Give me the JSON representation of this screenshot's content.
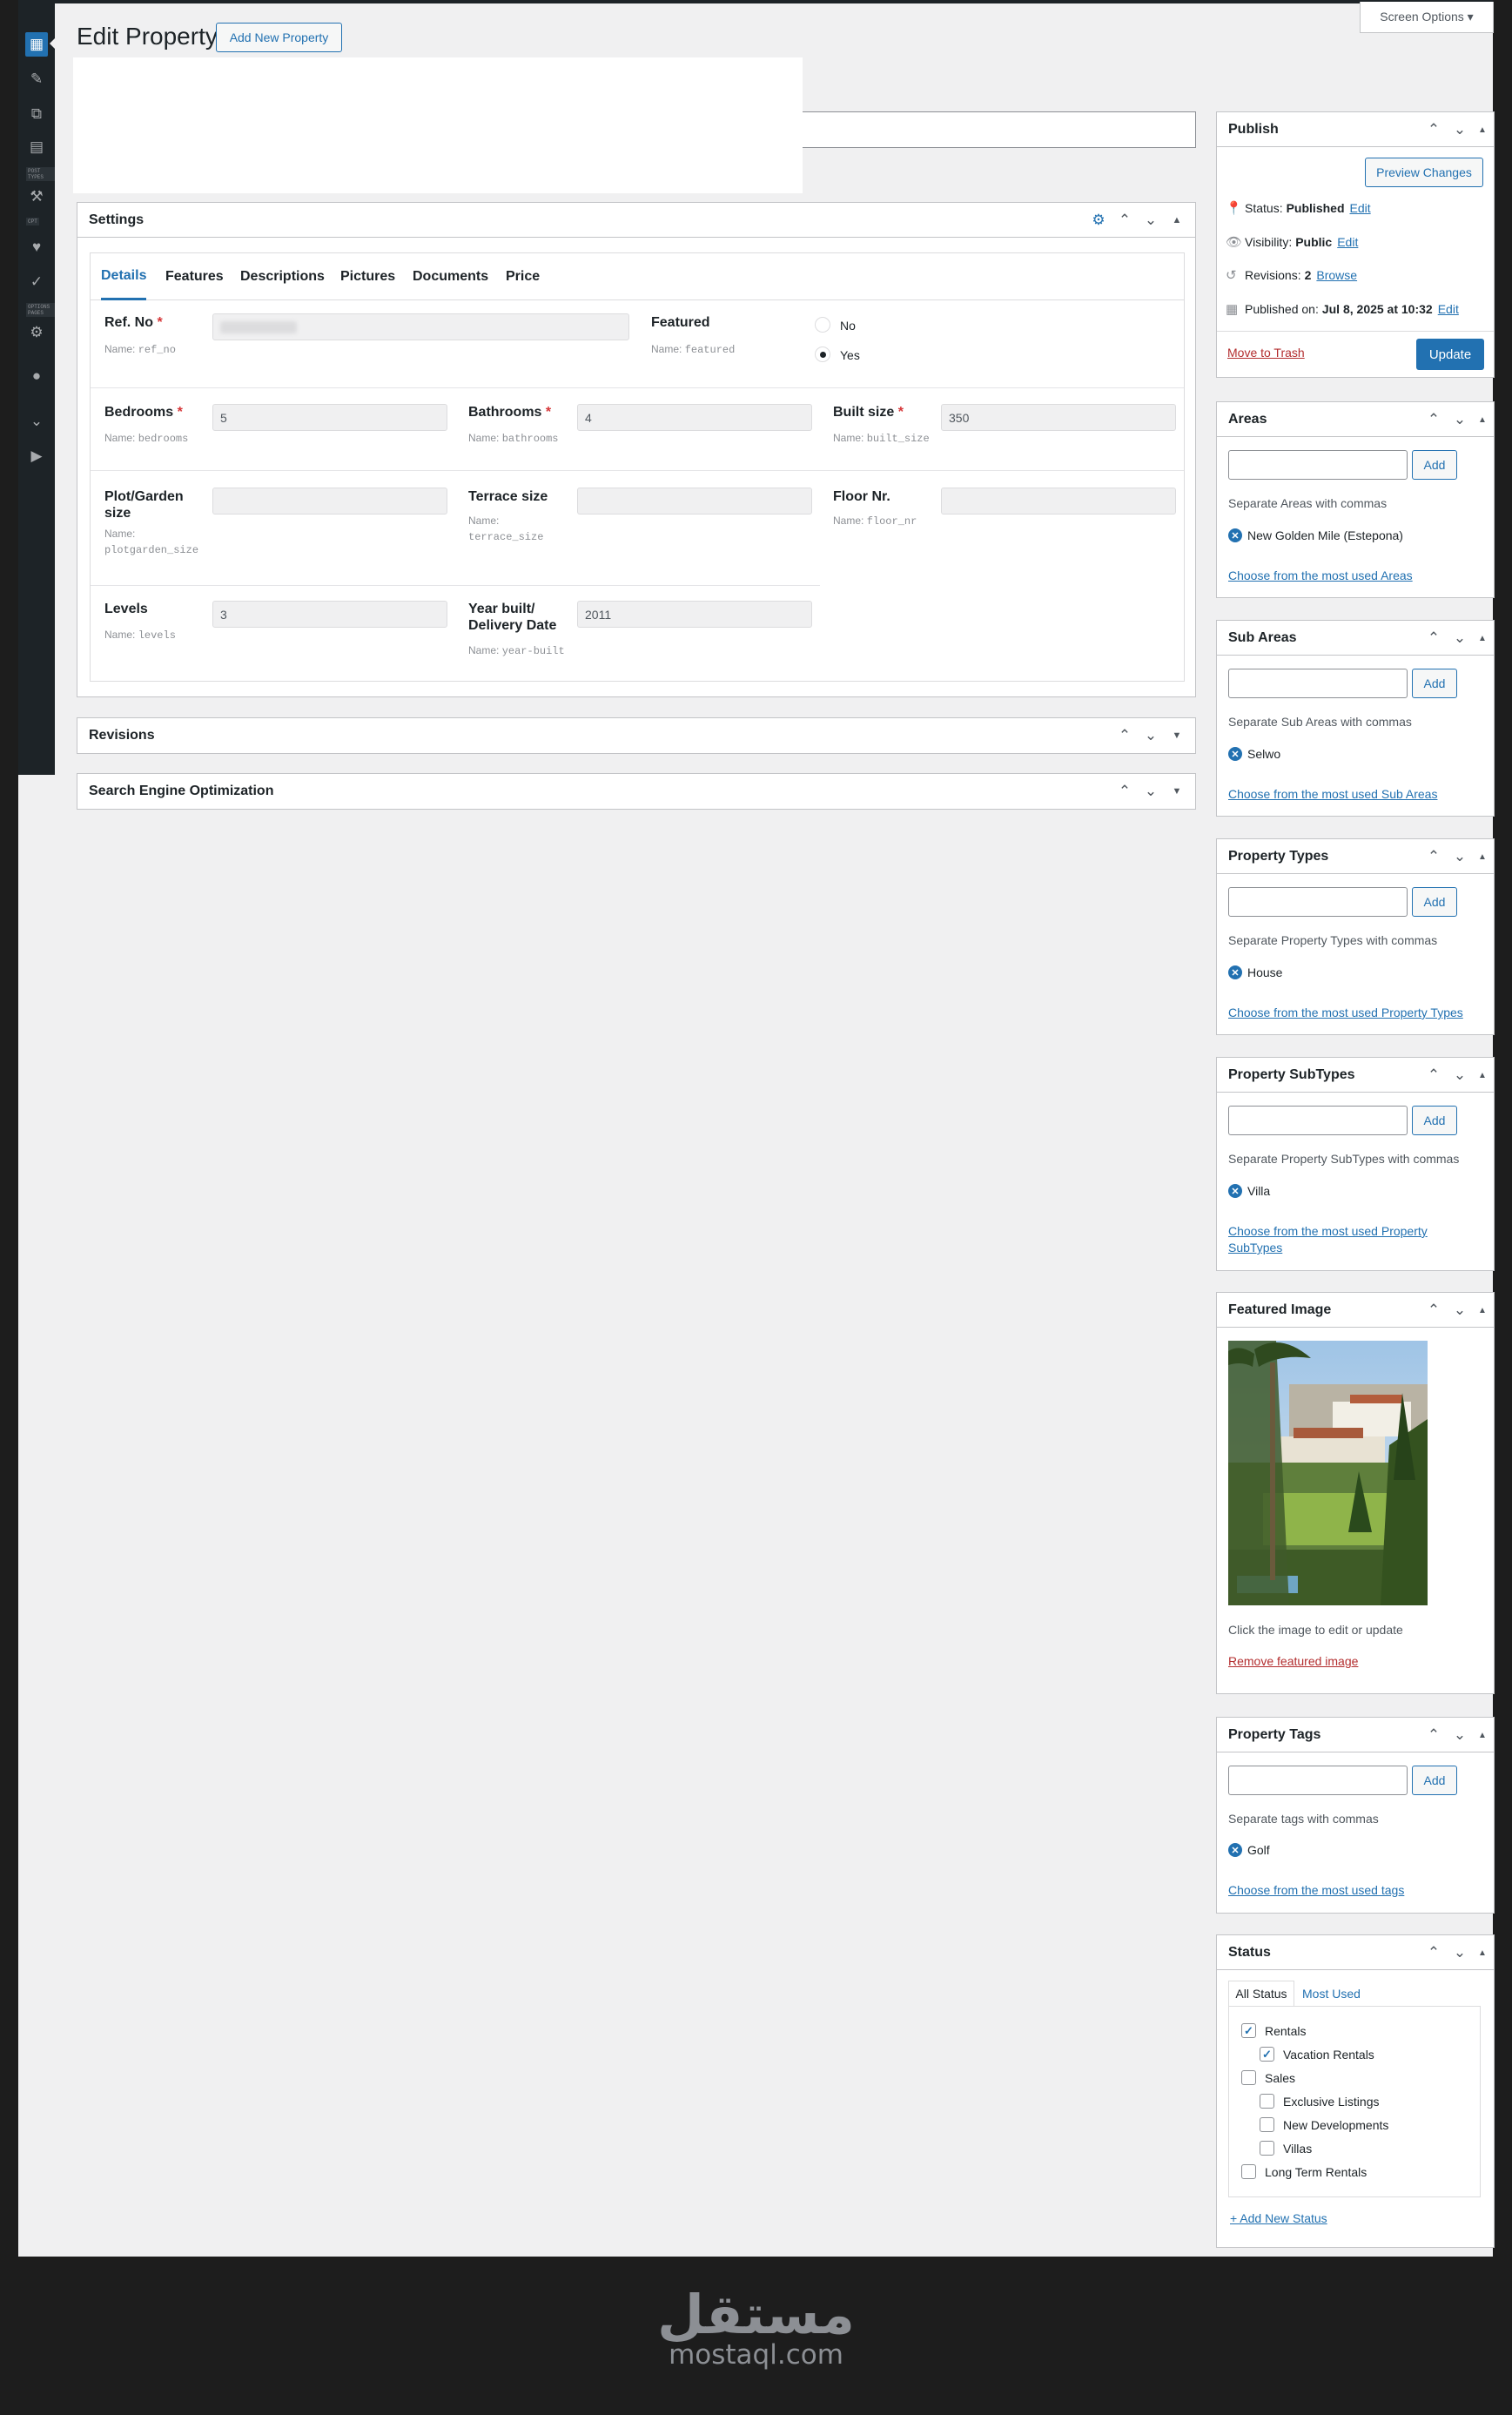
{
  "header": {
    "title": "Edit Property",
    "add_new_label": "Add New Property",
    "screen_options_label": "Screen Options ▾"
  },
  "sidebar": {
    "sections": [
      "POST TYPES",
      "CPT",
      "OPTIONS PAGES"
    ],
    "icons": [
      "building-icon",
      "pin-icon",
      "media-icon",
      "pages-icon",
      "wrench-icon",
      "heart-icon",
      "check-icon",
      "tools-icon",
      "user-icon",
      "collapse-icon",
      "play-icon"
    ]
  },
  "settings": {
    "title": "Settings",
    "tabs": [
      "Details",
      "Features",
      "Descriptions",
      "Pictures",
      "Documents",
      "Price"
    ],
    "active_tab": "Details",
    "fields": {
      "ref_no": {
        "label": "Ref. No",
        "required": "*",
        "name_prefix": "Name:",
        "name": "ref_no",
        "value": ""
      },
      "featured": {
        "label": "Featured",
        "name_prefix": "Name:",
        "name": "featured",
        "options": [
          "No",
          "Yes"
        ],
        "selected": "Yes"
      },
      "bedrooms": {
        "label": "Bedrooms",
        "required": "*",
        "name_prefix": "Name:",
        "name": "bedrooms",
        "value": "5"
      },
      "bathrooms": {
        "label": "Bathrooms",
        "required": "*",
        "name_prefix": "Name:",
        "name": "bathrooms",
        "value": "4"
      },
      "built_size": {
        "label": "Built size",
        "required": "*",
        "name_prefix": "Name:",
        "name": "built_size",
        "value": "350"
      },
      "plot_size": {
        "label_line1": "Plot/Garden",
        "label_line2": "size",
        "name_prefix": "Name:",
        "name": "plotgarden_size",
        "value": ""
      },
      "terrace_size": {
        "label": "Terrace size",
        "name_prefix": "Name:",
        "name": "terrace_size",
        "value": ""
      },
      "floor_nr": {
        "label": "Floor Nr.",
        "name_prefix": "Name:",
        "name": "floor_nr",
        "value": ""
      },
      "levels": {
        "label": "Levels",
        "name_prefix": "Name:",
        "name": "levels",
        "value": "3"
      },
      "year_built": {
        "label_line1": "Year built/",
        "label_line2": "Delivery Date",
        "name_prefix": "Name:",
        "name": "year-built",
        "value": "2011"
      }
    }
  },
  "revisions_box": {
    "title": "Revisions"
  },
  "seo_box": {
    "title": "Search Engine Optimization"
  },
  "publish": {
    "title": "Publish",
    "preview_label": "Preview Changes",
    "status_label": "Status:",
    "status_value": "Published",
    "status_edit": "Edit",
    "visibility_label": "Visibility:",
    "visibility_value": "Public",
    "visibility_edit": "Edit",
    "revisions_label": "Revisions:",
    "revisions_value": "2",
    "revisions_browse": "Browse",
    "published_label": "Published on:",
    "published_value": "Jul 8, 2025 at 10:32",
    "published_edit": "Edit",
    "trash_label": "Move to Trash",
    "update_label": "Update"
  },
  "taxonomies": {
    "areas": {
      "title": "Areas",
      "add": "Add",
      "hint": "Separate Areas with commas",
      "tag": "New Golden Mile (Estepona)",
      "link": "Choose from the most used Areas"
    },
    "sub_areas": {
      "title": "Sub Areas",
      "add": "Add",
      "hint": "Separate Sub Areas with commas",
      "tag": "Selwo",
      "link": "Choose from the most used Sub Areas"
    },
    "types": {
      "title": "Property Types",
      "add": "Add",
      "hint": "Separate Property Types with commas",
      "tag": "House",
      "link": "Choose from the most used Property Types"
    },
    "subtypes": {
      "title": "Property SubTypes",
      "add": "Add",
      "hint": "Separate Property SubTypes with commas",
      "tag": "Villa",
      "link_line1": "Choose from the most used Property",
      "link_line2": "SubTypes"
    },
    "tags": {
      "title": "Property Tags",
      "add": "Add",
      "hint": "Separate tags with commas",
      "tag": "Golf",
      "link": "Choose from the most used tags"
    }
  },
  "featured_image": {
    "title": "Featured Image",
    "hint": "Click the image to edit or update",
    "remove": "Remove featured image"
  },
  "status_box": {
    "title": "Status",
    "tab_all": "All Status",
    "tab_most": "Most Used",
    "items": [
      {
        "label": "Rentals",
        "checked": true
      },
      {
        "label": "Vacation Rentals",
        "checked": true
      },
      {
        "label": "Sales",
        "checked": false
      },
      {
        "label": "Exclusive Listings",
        "checked": false
      },
      {
        "label": "New Developments",
        "checked": false
      },
      {
        "label": "Villas",
        "checked": false
      },
      {
        "label": "Long Term Rentals",
        "checked": false
      }
    ],
    "add_new": "+ Add New Status"
  },
  "footer": {
    "logo_ar": "مستقل",
    "logo_en": "mostaql.com"
  },
  "colors": {
    "accent": "#2271b1",
    "danger": "#b32d2e",
    "admin_bg": "#1d2327",
    "page_bg": "#f0f0f1"
  }
}
